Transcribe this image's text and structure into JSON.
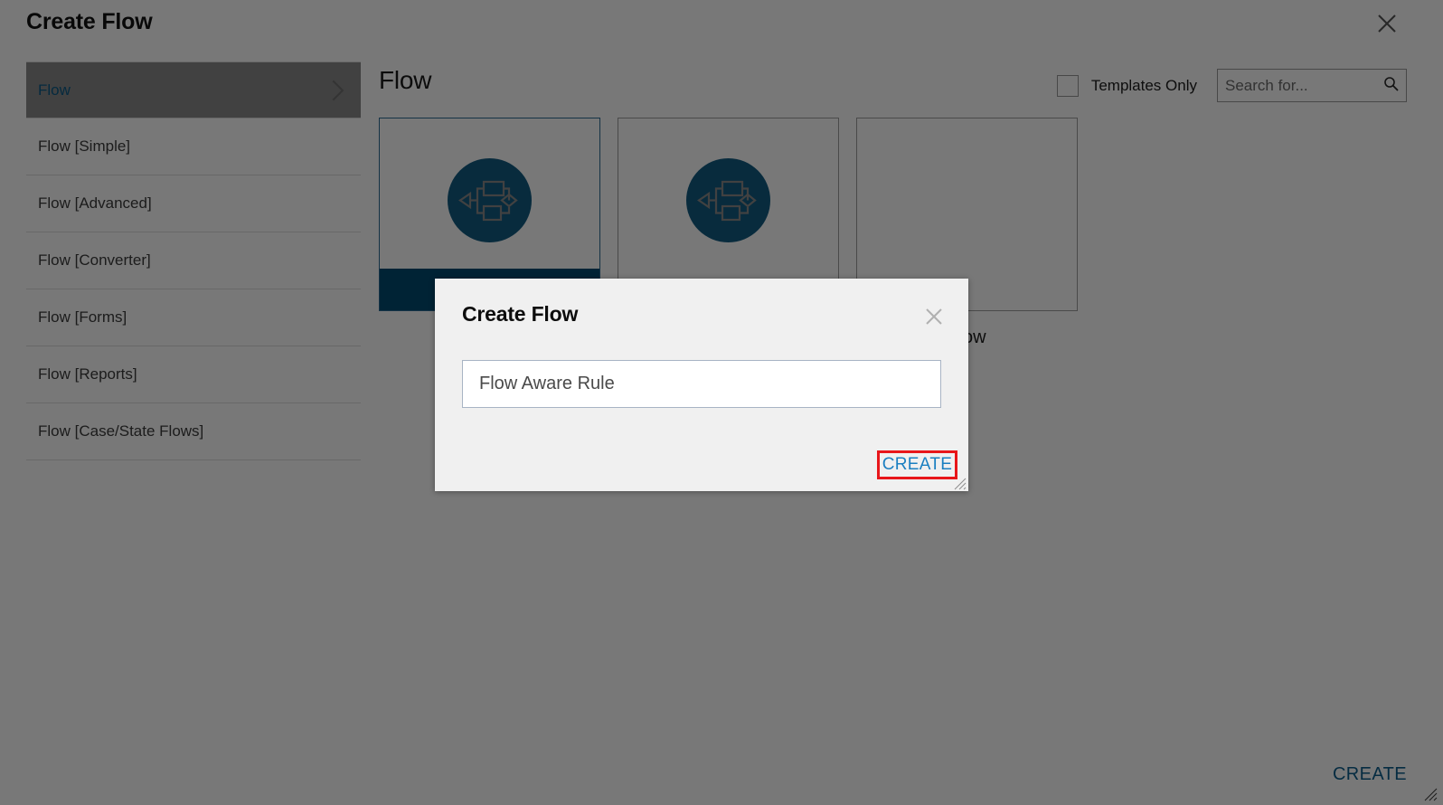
{
  "page": {
    "title": "Create Flow",
    "close_icon": "close-icon",
    "create_label": "CREATE"
  },
  "sidebar": {
    "items": [
      {
        "label": "Flow",
        "active": true,
        "chevron": "chevron-right-icon"
      },
      {
        "label": "Flow [Simple]",
        "active": false
      },
      {
        "label": "Flow [Advanced]",
        "active": false
      },
      {
        "label": "Flow [Converter]",
        "active": false
      },
      {
        "label": "Flow [Forms]",
        "active": false
      },
      {
        "label": "Flow [Reports]",
        "active": false
      },
      {
        "label": "Flow [Case/State Flows]",
        "active": false
      }
    ]
  },
  "main": {
    "heading": "Flow",
    "templates_only_label": "Templates Only",
    "templates_only_checked": false,
    "search": {
      "placeholder": "Search for...",
      "value": "",
      "icon": "search-icon"
    },
    "tiles": [
      {
        "icon": "flow-diagram-icon",
        "label": "",
        "selected": true
      },
      {
        "icon": "flow-diagram-icon",
        "label": "",
        "selected": false
      },
      {
        "icon": "flow-preview-icon",
        "label": "Flow",
        "selected": false
      }
    ]
  },
  "modal": {
    "title": "Create Flow",
    "close_icon": "close-icon",
    "name_field": {
      "value": "Flow Aware Rule",
      "placeholder": "Flow Aware Rule"
    },
    "create_label": "CREATE",
    "resize_handle": "resize-grip-icon"
  },
  "colors": {
    "brand_blue": "#014b72",
    "link_blue": "#1a7fc1",
    "accent_blue": "#0d5f8c",
    "highlight_red": "#e8161a",
    "overlay": "#787878",
    "modal_bg": "#f0f0f0"
  }
}
